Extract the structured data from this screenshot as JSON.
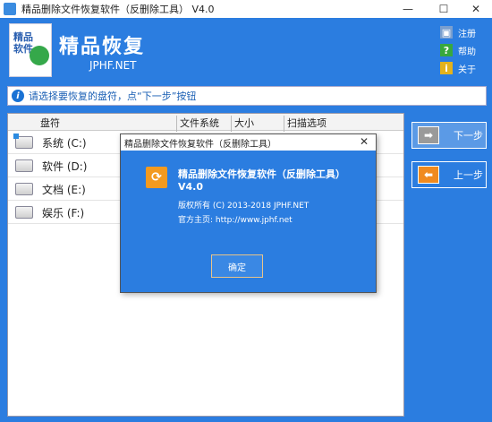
{
  "window": {
    "title": "精品删除文件恢复软件（反删除工具）  V4.0",
    "minimize": "—",
    "maximize": "☐",
    "close": "✕"
  },
  "header": {
    "logo_text": "精品软件",
    "brand_title": "精品恢复",
    "brand_sub": "JPHF.NET",
    "links": [
      {
        "label": "注册",
        "icon": "cart-icon"
      },
      {
        "label": "帮助",
        "icon": "help-icon",
        "glyph": "?"
      },
      {
        "label": "关于",
        "icon": "info-icon",
        "glyph": "i"
      }
    ]
  },
  "hint": {
    "icon_glyph": "i",
    "text": "请选择要恢复的盘符，点“下一步”按钮"
  },
  "table": {
    "columns": [
      "盘符",
      "文件系统",
      "大小",
      "扫描选项"
    ],
    "rows": [
      {
        "label": "系统 (C:)"
      },
      {
        "label": "软件 (D:)"
      },
      {
        "label": "文档 (E:)"
      },
      {
        "label": "娱乐 (F:)"
      }
    ]
  },
  "buttons": {
    "next": {
      "label": "下一步",
      "glyph": "➡"
    },
    "prev": {
      "label": "上一步",
      "glyph": "⬅"
    }
  },
  "dialog": {
    "title": "精品删除文件恢复软件（反删除工具）",
    "close": "✕",
    "icon_glyph": "⟳",
    "app_name": "精品删除文件恢复软件（反删除工具）",
    "version": "V4.0",
    "copyright": "版权所有 (C) 2013-2018 JPHF.NET",
    "homepage": "官方主页: http://www.jphf.net",
    "ok": "确定"
  },
  "colors": {
    "accent": "#2b7de0",
    "dialog_icon": "#f39a1f",
    "logo_arrow": "#35a84a"
  }
}
